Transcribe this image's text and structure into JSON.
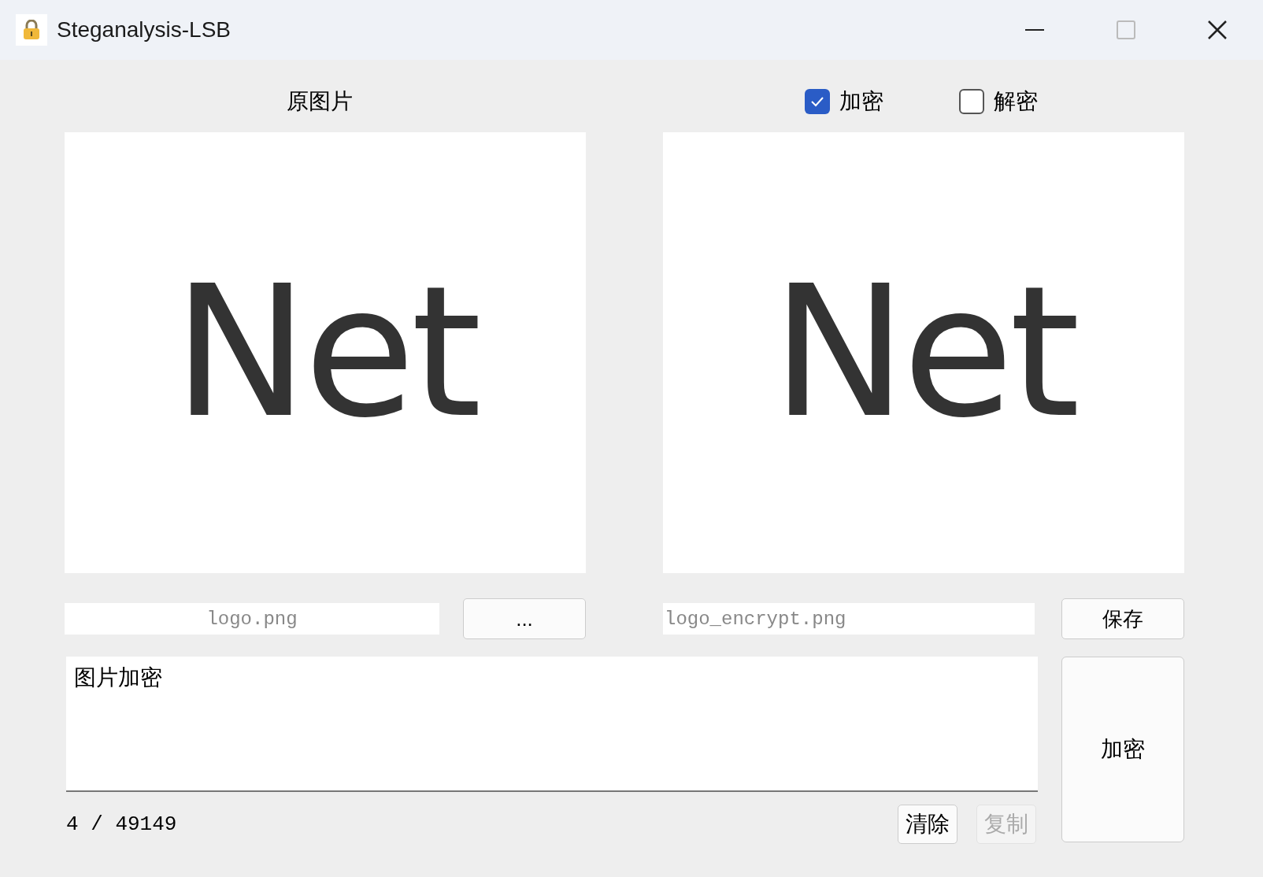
{
  "window": {
    "title": "Steganalysis-LSB"
  },
  "source": {
    "label": "原图片",
    "image_text": "Net",
    "filename": "logo.png",
    "browse_button": "..."
  },
  "modes": [
    {
      "label": "加密",
      "checked": true
    },
    {
      "label": "解密",
      "checked": false
    }
  ],
  "result": {
    "image_text": "Net",
    "filename": "logo_encrypt.png",
    "save_button": "保存"
  },
  "message": {
    "value": "图片加密",
    "counter": "4 / 49149"
  },
  "buttons": [
    {
      "label": "清除",
      "disabled": false
    },
    {
      "label": "复制",
      "disabled": true
    }
  ],
  "action_button": "加密"
}
